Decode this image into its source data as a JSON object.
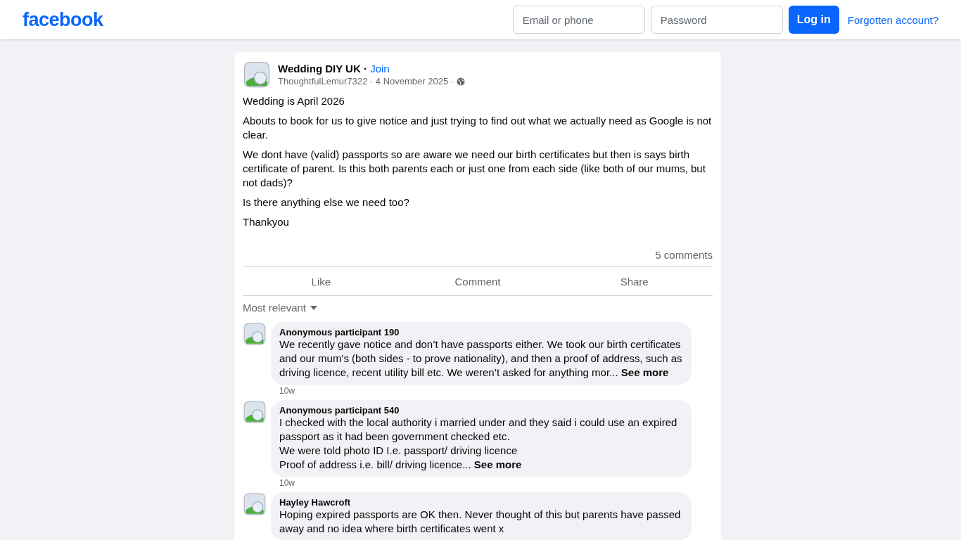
{
  "header": {
    "logo": "facebook",
    "email_placeholder": "Email or phone",
    "password_placeholder": "Password",
    "login_button": "Log in",
    "forgot_link": "Forgotten account?"
  },
  "post": {
    "separator": "·",
    "group": "Wedding DIY UK",
    "join": "Join",
    "author": "ThoughtfulLemur7322",
    "date": "4 November 2025",
    "paragraphs": [
      "Wedding is April 2026",
      "Abouts to book for us to give notice and just trying to find out what we actually need as Google is not clear.",
      "We dont have (valid) passports so are aware we need our birth certificates but then is says birth certificate of parent. Is this both parents each or just one from each side (like both of our mums, but not dads)?",
      "Is there anything else we need too?",
      "Thankyou"
    ],
    "comment_count": "5 comments",
    "actions": [
      "Like",
      "Comment",
      "Share"
    ]
  },
  "sort": "Most relevant",
  "comments": [
    {
      "name": "Anonymous participant 190",
      "text": "We recently gave notice and don’t have passports either. We took our birth certificates and our mum’s (both sides - to prove nationality), and then a proof of address, such as driving licence, recent utility bill etc. We weren’t asked for anything mor...",
      "see_more": "See more",
      "time": "10w"
    },
    {
      "name": "Anonymous participant 540",
      "text": "I checked with the local authority i married under and they said i could use an expired passport as it had been government checked etc.\nWe were told photo ID I.e. passport/ driving licence\nProof of address i.e. bill/ driving licence...",
      "see_more": "See more",
      "time": "10w"
    },
    {
      "name": "Hayley Hawcroft",
      "text": "Hoping expired passports are OK then. Never thought of this but parents have passed away and no idea where birth certificates went x"
    }
  ]
}
